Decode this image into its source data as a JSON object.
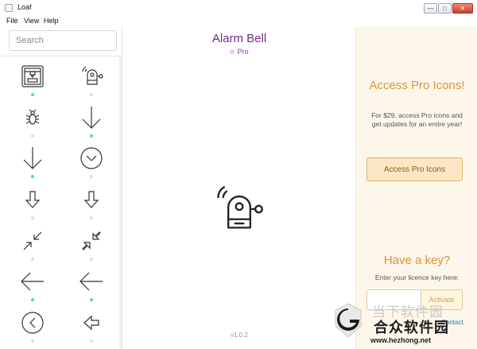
{
  "window": {
    "title": "Loaf",
    "controls": {
      "minimize": "—",
      "maximize": "□",
      "close": "✕"
    }
  },
  "menu": [
    "File",
    "View",
    "Help"
  ],
  "sidebar": {
    "search_placeholder": "Search",
    "icons": [
      {
        "icon": "3d-printer-icon",
        "dot": "#4ee0a6"
      },
      {
        "icon": "alarm-bell-icon",
        "dot": "#f2cff2"
      },
      {
        "icon": "bug-icon",
        "dot": "#f2cff2"
      },
      {
        "icon": "arrow-down-icon",
        "dot": "#4ee0a6"
      },
      {
        "icon": "arrow-down-icon",
        "dot": "#4ee0a6"
      },
      {
        "icon": "arrow-down-circle-icon",
        "dot": "#f2cff2"
      },
      {
        "icon": "arrow-down-outline-icon",
        "dot": "#f2cff2"
      },
      {
        "icon": "arrow-down-outline-icon",
        "dot": "#f2cff2"
      },
      {
        "icon": "arrows-collapse-icon",
        "dot": "#f2cff2"
      },
      {
        "icon": "arrows-collapse-outline-icon",
        "dot": "#f2cff2"
      },
      {
        "icon": "arrow-left-icon",
        "dot": "#4ee0a6"
      },
      {
        "icon": "arrow-left-icon",
        "dot": "#4ee0a6"
      },
      {
        "icon": "arrow-left-circle-icon",
        "dot": "#f2cff2"
      },
      {
        "icon": "arrow-left-outline-icon",
        "dot": "#f2cff2"
      }
    ]
  },
  "detail": {
    "name": "Alarm Bell",
    "tier": "Pro",
    "version": "v1.0.2"
  },
  "promo": {
    "title": "Access Pro Icons!",
    "text": "For $29, access Pro icons and get updates for an entire year!",
    "button": "Access Pro Icons",
    "key_title": "Have a key?",
    "key_text": "Enter your licence key here:",
    "key_placeholder": "",
    "activate": "Activate",
    "contact": "Contact"
  },
  "watermark": {
    "line1": "当下软件园",
    "line2": "合众软件园",
    "url": "www.hezhong.net"
  },
  "colors": {
    "accent_purple": "#6e2a86",
    "promo_orange": "#d9943a",
    "free_dot": "#4ee0a6",
    "pro_dot": "#f2cff2"
  }
}
